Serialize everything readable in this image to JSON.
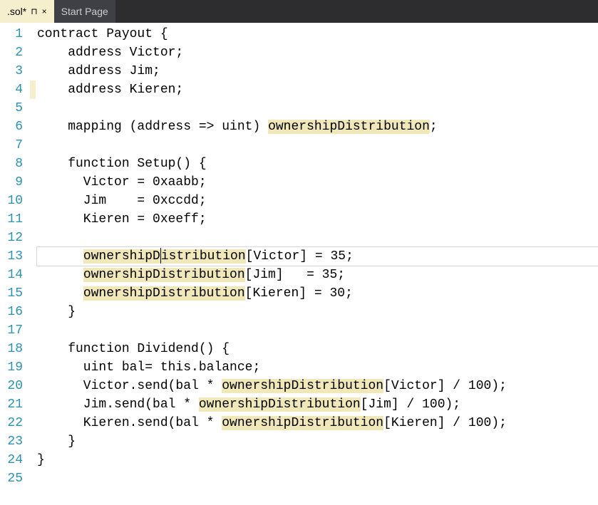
{
  "tabs": {
    "active": {
      "label": ".sol*",
      "pin": "⊓",
      "close": "×"
    },
    "inactive": {
      "label": "Start Page"
    }
  },
  "highlightWord": "ownershipDistribution",
  "currentLine": 13,
  "lines": [
    "contract Payout {",
    "    address Victor;",
    "    address Jim;",
    "    address Kieren;",
    "",
    "    mapping (address => uint) ownershipDistribution;",
    "",
    "    function Setup() {",
    "      Victor = 0xaabb;",
    "      Jim    = 0xccdd;",
    "      Kieren = 0xeeff;",
    "",
    "      ownershipDistribution[Victor] = 35;",
    "      ownershipDistribution[Jim]   = 35;",
    "      ownershipDistribution[Kieren] = 30;",
    "    }",
    "",
    "    function Dividend() {",
    "      uint bal= this.balance;",
    "      Victor.send(bal * ownershipDistribution[Victor] / 100);",
    "      Jim.send(bal * ownershipDistribution[Jim] / 100);",
    "      Kieren.send(bal * ownershipDistribution[Kieren] / 100);",
    "    }",
    "}",
    ""
  ],
  "changedMarkers": [
    4
  ]
}
